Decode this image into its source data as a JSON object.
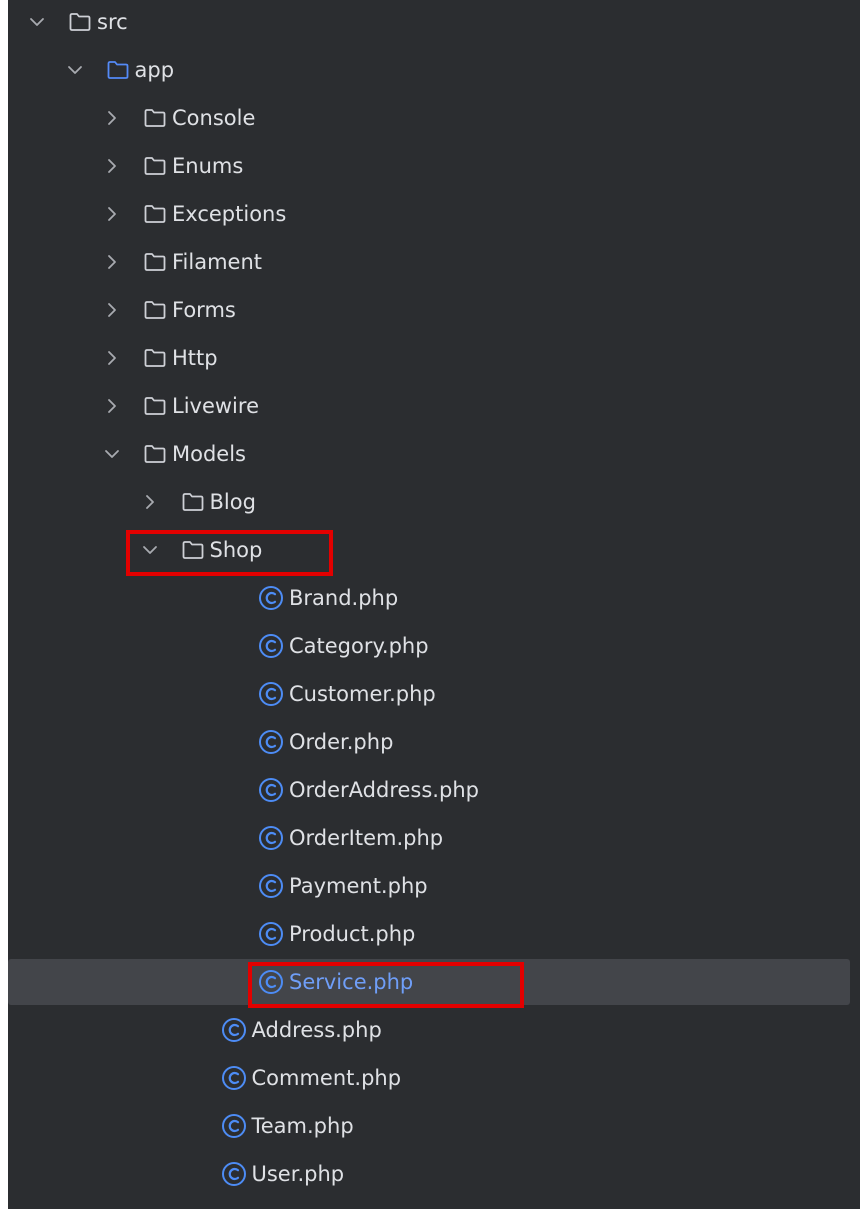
{
  "tree": [
    {
      "name": "src",
      "kind": "folder",
      "depth": 0,
      "state": "expanded",
      "icon": "folder-icon"
    },
    {
      "name": "app",
      "kind": "folder",
      "depth": 1,
      "state": "expanded",
      "icon": "folder-icon",
      "accent": true
    },
    {
      "name": "Console",
      "kind": "folder",
      "depth": 2,
      "state": "collapsed",
      "icon": "folder-icon"
    },
    {
      "name": "Enums",
      "kind": "folder",
      "depth": 2,
      "state": "collapsed",
      "icon": "folder-icon"
    },
    {
      "name": "Exceptions",
      "kind": "folder",
      "depth": 2,
      "state": "collapsed",
      "icon": "folder-icon"
    },
    {
      "name": "Filament",
      "kind": "folder",
      "depth": 2,
      "state": "collapsed",
      "icon": "folder-icon"
    },
    {
      "name": "Forms",
      "kind": "folder",
      "depth": 2,
      "state": "collapsed",
      "icon": "folder-icon"
    },
    {
      "name": "Http",
      "kind": "folder",
      "depth": 2,
      "state": "collapsed",
      "icon": "folder-icon"
    },
    {
      "name": "Livewire",
      "kind": "folder",
      "depth": 2,
      "state": "collapsed",
      "icon": "folder-icon"
    },
    {
      "name": "Models",
      "kind": "folder",
      "depth": 2,
      "state": "expanded",
      "icon": "folder-icon"
    },
    {
      "name": "Blog",
      "kind": "folder",
      "depth": 3,
      "state": "collapsed",
      "icon": "folder-icon"
    },
    {
      "name": "Shop",
      "kind": "folder",
      "depth": 3,
      "state": "expanded",
      "icon": "folder-icon",
      "highlighted": true
    },
    {
      "name": "Brand.php",
      "kind": "class",
      "depth": 4,
      "icon": "php-class-icon"
    },
    {
      "name": "Category.php",
      "kind": "class",
      "depth": 4,
      "icon": "php-class-icon"
    },
    {
      "name": "Customer.php",
      "kind": "class",
      "depth": 4,
      "icon": "php-class-icon"
    },
    {
      "name": "Order.php",
      "kind": "class",
      "depth": 4,
      "icon": "php-class-icon"
    },
    {
      "name": "OrderAddress.php",
      "kind": "class",
      "depth": 4,
      "icon": "php-class-icon"
    },
    {
      "name": "OrderItem.php",
      "kind": "class",
      "depth": 4,
      "icon": "php-class-icon"
    },
    {
      "name": "Payment.php",
      "kind": "class",
      "depth": 4,
      "icon": "php-class-icon"
    },
    {
      "name": "Product.php",
      "kind": "class",
      "depth": 4,
      "icon": "php-class-icon"
    },
    {
      "name": "Service.php",
      "kind": "class",
      "depth": 4,
      "icon": "php-class-icon",
      "selected": true,
      "highlighted": true
    },
    {
      "name": "Address.php",
      "kind": "class",
      "depth": 3,
      "icon": "php-class-icon"
    },
    {
      "name": "Comment.php",
      "kind": "class",
      "depth": 3,
      "icon": "php-class-icon"
    },
    {
      "name": "Team.php",
      "kind": "class",
      "depth": 3,
      "icon": "php-class-icon"
    },
    {
      "name": "User.php",
      "kind": "class",
      "depth": 3,
      "icon": "php-class-icon"
    }
  ],
  "colors": {
    "panel_background": "#2b2d30",
    "text": "#dfe1e5",
    "selected_row_background": "#43454a",
    "selected_text": "#6f9ef8",
    "class_icon": "#4d8cf5",
    "folder_icon": "#ced0d6",
    "accent_folder_icon": "#548af7",
    "highlight_box": "#e30000"
  }
}
